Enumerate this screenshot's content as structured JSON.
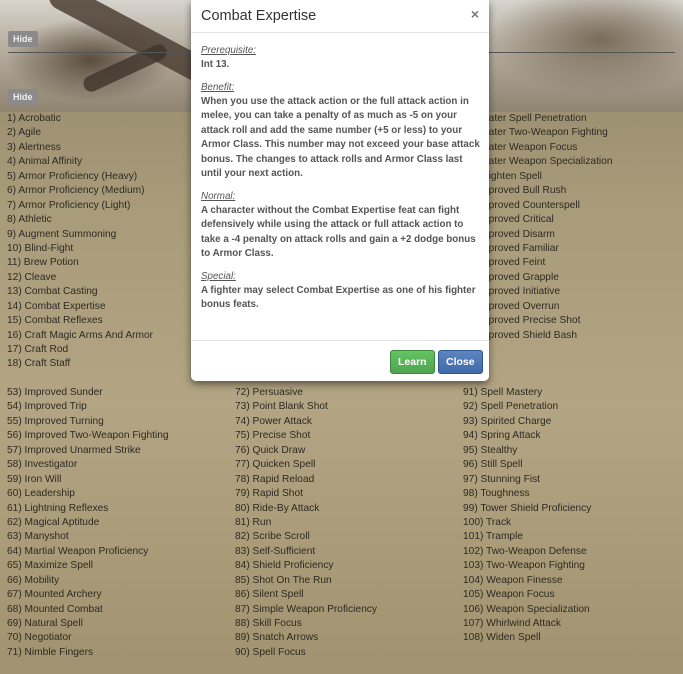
{
  "buttons": {
    "hide1": "Hide",
    "hide2": "Hide"
  },
  "feats": {
    "col1_top": [
      "1) Acrobatic",
      "2) Agile",
      "3) Alertness",
      "4) Animal Affinity",
      "5) Armor Proficiency (Heavy)",
      "6) Armor Proficiency (Medium)",
      "7) Armor Proficiency (Light)",
      "8) Athletic",
      "9) Augment Summoning",
      "10) Blind-Fight",
      "11) Brew Potion",
      "12) Cleave",
      "13) Combat Casting",
      "14) Combat Expertise",
      "15) Combat Reflexes",
      "16) Craft Magic Arms And Armor",
      "17) Craft Rod",
      "18) Craft Staff"
    ],
    "col3_top": [
      "eater Spell Penetration",
      "eater Two-Weapon Fighting",
      "eater Weapon Focus",
      "eater Weapon Specialization",
      "eighten Spell",
      "nproved Bull Rush",
      "nproved Counterspell",
      "nproved Critical",
      "nproved Disarm",
      "nproved Familiar",
      "nproved Feint",
      "nproved Grapple",
      "nproved Initiative",
      "nproved Overrun",
      "nproved Precise Shot",
      "nproved Shield Bash"
    ],
    "col1_bottom": [
      "53) Improved Sunder",
      "54) Improved Trip",
      "55) Improved Turning",
      "56) Improved Two-Weapon Fighting",
      "57) Improved Unarmed Strike",
      "58) Investigator",
      "59) Iron Will",
      "60) Leadership",
      "61) Lightning Reflexes",
      "62) Magical Aptitude",
      "63) Manyshot",
      "64) Martial Weapon Proficiency",
      "65) Maximize Spell",
      "66) Mobility",
      "67) Mounted Archery",
      "68) Mounted Combat",
      "69) Natural Spell",
      "70) Negotiator",
      "71) Nimble Fingers"
    ],
    "col2_bottom": [
      "72) Persuasive",
      "73) Point Blank Shot",
      "74) Power Attack",
      "75) Precise Shot",
      "76) Quick Draw",
      "77) Quicken Spell",
      "78) Rapid Reload",
      "79) Rapid Shot",
      "80) Ride-By Attack",
      "81) Run",
      "82) Scribe Scroll",
      "83) Self-Sufficient",
      "84) Shield Proficiency",
      "85) Shot On The Run",
      "86) Silent Spell",
      "87) Simple Weapon Proficiency",
      "88) Skill Focus",
      "89) Snatch Arrows",
      "90) Spell Focus"
    ],
    "col3_bottom": [
      "91) Spell Mastery",
      "92) Spell Penetration",
      "93) Spirited Charge",
      "94) Spring Attack",
      "95) Stealthy",
      "96) Still Spell",
      "97) Stunning Fist",
      "98) Toughness",
      "99) Tower Shield Proficiency",
      "100) Track",
      "101) Trample",
      "102) Two-Weapon Defense",
      "103) Two-Weapon Fighting",
      "104) Weapon Finesse",
      "105) Weapon Focus",
      "106) Weapon Specialization",
      "107) Whirlwind Attack",
      "108) Widen Spell"
    ]
  },
  "modal": {
    "title": "Combat Expertise",
    "close_symbol": "×",
    "prerequisite_heading": "Prerequisite:",
    "prerequisite_text": "Int 13.",
    "benefit_heading": "Benefit:",
    "benefit_text": "When you use the attack action or the full attack action in melee, you can take a penalty of as much as -5 on your attack roll and add the same number (+5 or less) to your Armor Class. This number may not exceed your base attack bonus. The changes to attack rolls and Armor Class last until your next action.",
    "normal_heading": "Normal:",
    "normal_text": "A character without the Combat Expertise feat can fight defensively while using the attack or full attack action to take a -4 penalty on attack rolls and gain a +2 dodge bonus to Armor Class.",
    "special_heading": "Special:",
    "special_text": "A fighter may select Combat Expertise as one of his fighter bonus feats.",
    "learn_label": "Learn",
    "close_label": "Close"
  }
}
